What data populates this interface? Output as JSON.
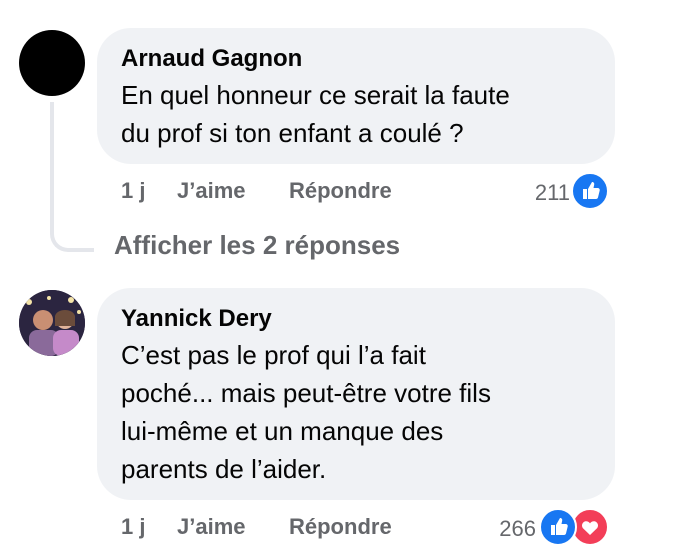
{
  "comments": [
    {
      "author": "Arnaud Gagnon",
      "text_lines": [
        "En quel honneur ce serait la faute",
        "du prof si ton enfant a coulé ?"
      ],
      "time": "1 j",
      "like_label": "J’aime",
      "reply_label": "Répondre",
      "reaction_count": "211",
      "reactions": [
        "like-icon"
      ]
    },
    {
      "author": "Yannick Dery",
      "text_lines": [
        "C’est pas le prof qui l’a fait",
        "poché... mais peut-être votre fils",
        "lui-même et un manque des",
        "parents de l’aider."
      ],
      "time": "1 j",
      "like_label": "J’aime",
      "reply_label": "Répondre",
      "reaction_count": "266",
      "reactions": [
        "like-icon",
        "love-icon"
      ]
    }
  ],
  "thread": {
    "more_replies_label": "Afficher les 2 réponses"
  },
  "colors": {
    "bubble": "#f0f2f5",
    "meta_text": "#65676b",
    "like": "#1877f2",
    "love": "#f33e58"
  }
}
